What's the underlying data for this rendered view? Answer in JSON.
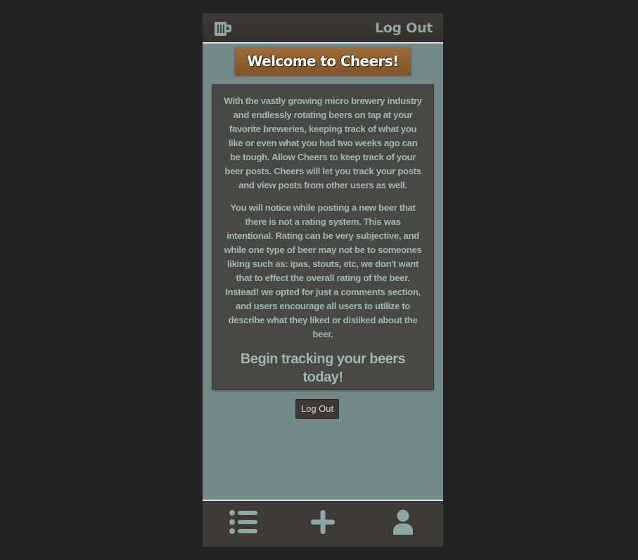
{
  "header": {
    "logo_icon": "beer-mug-icon",
    "logout_label": "Log Out"
  },
  "welcome": {
    "title": "Welcome to Cheers!"
  },
  "intro": {
    "paragraph1": "With the vastly growing micro brewery industry and endlessly rotating beers on tap at your favorite breweries, keeping track of what you like or even what you had two weeks ago can be tough. Allow Cheers to keep track of your beer posts. Cheers will let you track your posts and view posts from other users as well.",
    "paragraph2": "You will notice while posting a new beer that there is not a rating system. This was intentional. Rating can be very subjective, and while one type of beer may not be to someones liking such as: ipas, stouts, etc, we don't want that to effect the overall rating of the beer. Instead! we opted for just a comments section, and users encourage all users to utilize to describe what they liked or disliked about the beer.",
    "cta": "Begin tracking your beers today!"
  },
  "logout_button": {
    "label": "Log Out"
  },
  "bottom_nav": {
    "items": [
      {
        "icon": "list-icon"
      },
      {
        "icon": "plus-icon"
      },
      {
        "icon": "user-icon"
      }
    ]
  },
  "colors": {
    "background": "#232323",
    "content": "#73898a",
    "bar": "#3e3a36",
    "accent": "#8fa7a4",
    "welcome": "#8e5f30",
    "card": "#484845"
  }
}
